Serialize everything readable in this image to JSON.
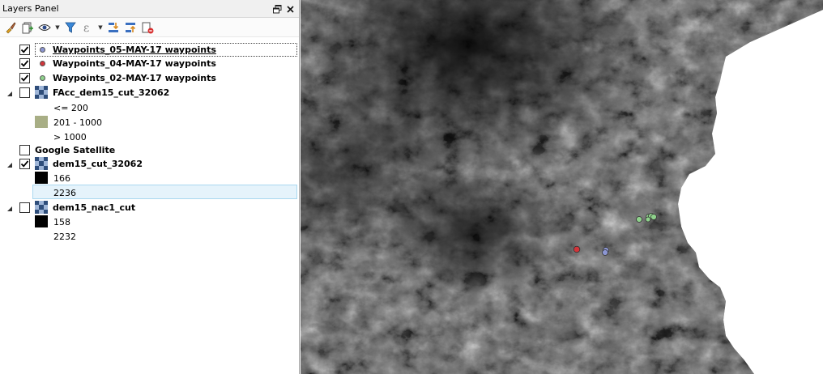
{
  "panel": {
    "title": "Layers Panel",
    "float_icon": "float-window-icon",
    "close_icon": "close-icon"
  },
  "toolbar": {
    "icons": [
      "paint-brush-icon",
      "add-group-icon",
      "eye-icon",
      "filter-icon",
      "expression-filter-icon",
      "expand-all-icon",
      "collapse-all-icon",
      "remove-layer-icon"
    ],
    "expression_glyph": "ε"
  },
  "layers": [
    {
      "name": "Waypoints_05-MAY-17 waypoints",
      "checked": true,
      "type": "point",
      "color": "#8c96d2"
    },
    {
      "name": "Waypoints_04-MAY-17 waypoints",
      "checked": true,
      "type": "point",
      "color": "#d2353a"
    },
    {
      "name": "Waypoints_02-MAY-17 waypoints",
      "checked": true,
      "type": "point",
      "color": "#8fd28c"
    },
    {
      "name": "FAcc_dem15_cut_32062",
      "checked": false,
      "type": "raster",
      "legend": [
        {
          "label": "<= 200",
          "color": "#ffffff"
        },
        {
          "label": "201 - 1000",
          "color": "#a8ae85"
        },
        {
          "label": "> 1000",
          "color": "#ffffff"
        }
      ]
    },
    {
      "name": "Google Satellite",
      "checked": false,
      "type": "tile"
    },
    {
      "name": "dem15_cut_32062",
      "checked": true,
      "type": "raster",
      "legend": [
        {
          "label": "166",
          "color": "#000000"
        },
        {
          "label": "2236",
          "color": "#ffffff"
        }
      ]
    },
    {
      "name": "dem15_nac1_cut",
      "checked": false,
      "type": "raster",
      "legend": [
        {
          "label": "158",
          "color": "#000000"
        },
        {
          "label": "2232",
          "color": "#ffffff"
        }
      ]
    }
  ],
  "map": {
    "waypoints_green_color": "#8fd28c",
    "waypoints_red_color": "#d2353a",
    "waypoints_blue_color": "#8c96d2"
  }
}
